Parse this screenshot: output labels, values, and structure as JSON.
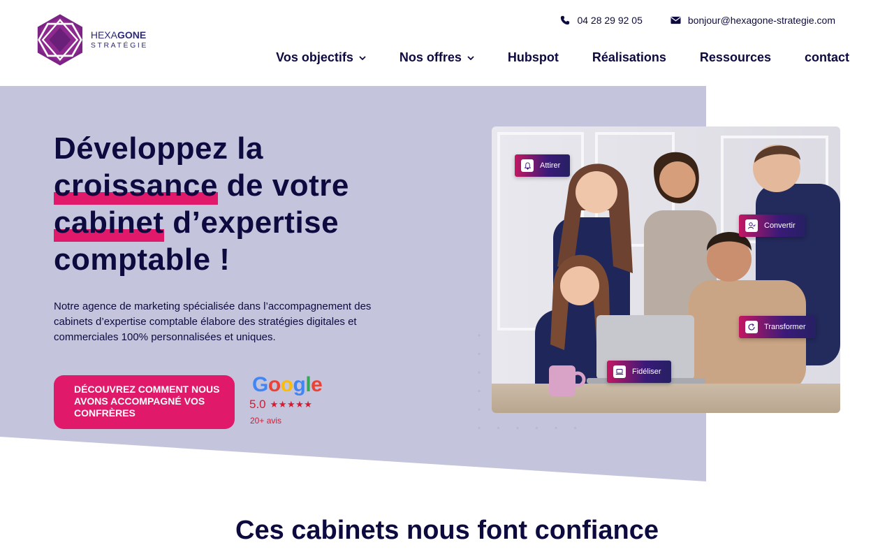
{
  "brand": {
    "logo_text_1": "HEXA",
    "logo_text_1b": "GONE",
    "logo_text_2": "STRATÉGIE",
    "primary_color": "#e0196b",
    "navy_color": "#0d0a3f",
    "hero_bg_color": "#c4c5dd"
  },
  "contact": {
    "phone": "04 28 29 92 05",
    "email": "bonjour@hexagone-strategie.com",
    "phone_icon": "phone-icon",
    "email_icon": "envelope-icon"
  },
  "nav": {
    "items": [
      {
        "label": "Vos objectifs",
        "has_dropdown": true
      },
      {
        "label": "Nos offres",
        "has_dropdown": true
      },
      {
        "label": "Hubspot",
        "has_dropdown": false
      },
      {
        "label": "Réalisations",
        "has_dropdown": false
      },
      {
        "label": "Ressources",
        "has_dropdown": false
      },
      {
        "label": "contact",
        "has_dropdown": false
      }
    ]
  },
  "hero": {
    "title_1": "Développez la",
    "title_2a": "croissance",
    "title_2b": " de votre",
    "title_3a": "cabinet",
    "title_3b": " d’expertise",
    "title_4": "comptable !",
    "description": "Notre agence de marketing spécialisée dans l’accompagnement des cabinets d’expertise comptable élabore des stratégies digitales et commerciales 100% personnalisées et uniques.",
    "cta_label": "Découvrez comment nous avons accompagné vos confrères"
  },
  "google_rating": {
    "brand": "Google",
    "score": "5.0",
    "stars": "★★★★★",
    "stars_value": 5,
    "reviews": "20+ avis"
  },
  "photo_tags": [
    {
      "label": "Attirer",
      "icon": "bell-icon"
    },
    {
      "label": "Convertir",
      "icon": "user-check-icon"
    },
    {
      "label": "Transformer",
      "icon": "refresh-icon"
    },
    {
      "label": "Fidéliser",
      "icon": "laptop-icon"
    }
  ],
  "trust_section": {
    "title": "Ces cabinets nous font confiance"
  }
}
